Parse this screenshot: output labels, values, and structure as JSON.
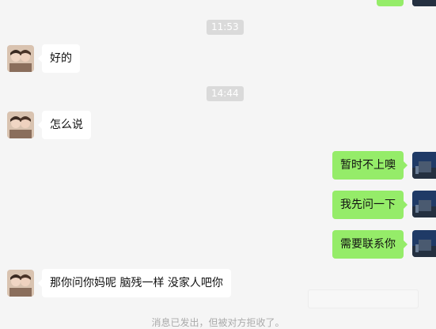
{
  "chat": {
    "messages": [
      {
        "type": "time",
        "text": "11:53"
      },
      {
        "type": "in",
        "text": "好的"
      },
      {
        "type": "time",
        "text": "14:44"
      },
      {
        "type": "in",
        "text": "怎么说"
      },
      {
        "type": "out",
        "text": "暂时不上噢"
      },
      {
        "type": "out",
        "text": "我先问一下"
      },
      {
        "type": "out",
        "text": "需要联系你"
      },
      {
        "type": "in",
        "text": "那你问你妈呢 脑残一样  没家人吧你"
      }
    ],
    "system_notice": "消息已发出，但被对方拒收了。"
  },
  "colors": {
    "background": "#f5f5f5",
    "incoming_bubble": "#ffffff",
    "outgoing_bubble": "#95ec69",
    "timestamp_bg": "#dadada"
  }
}
